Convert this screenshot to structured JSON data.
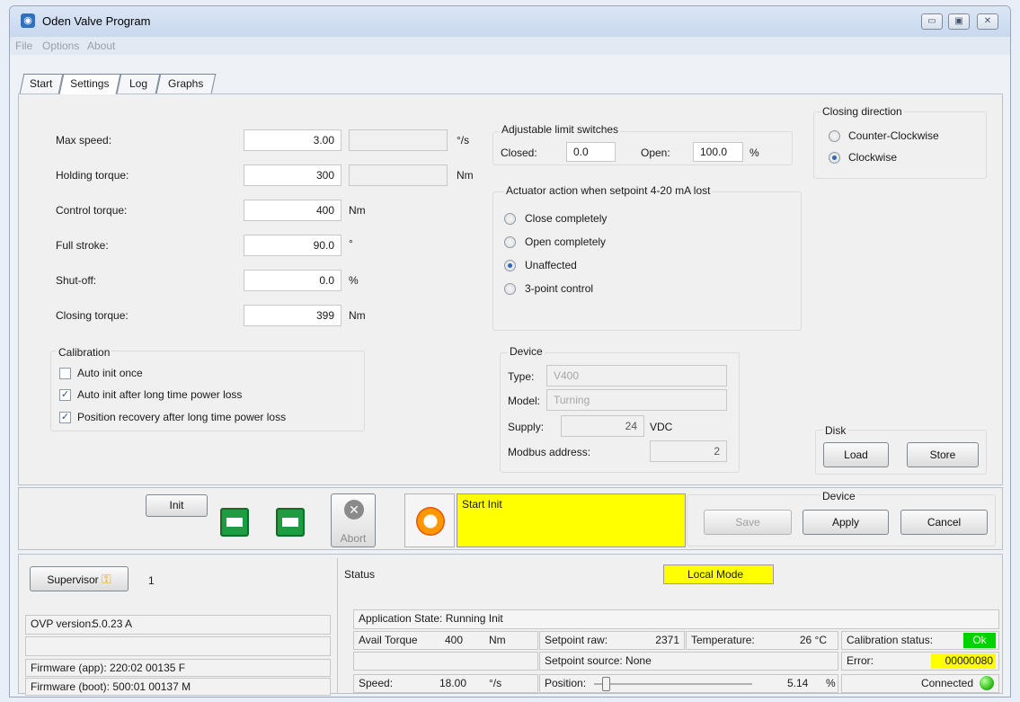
{
  "window": {
    "title": "Oden Valve Program",
    "menu": [
      "File",
      "Options",
      "About"
    ],
    "controls": [
      "minimize-icon",
      "maximize-icon",
      "close-icon"
    ]
  },
  "tabs": [
    "Start",
    "Settings",
    "Log",
    "Graphs"
  ],
  "active_tab": "Settings",
  "settings": {
    "max_speed": {
      "label": "Max speed:",
      "value": "3.00",
      "unit": "°/s"
    },
    "holding_torque": {
      "label": "Holding torque:",
      "value": "300",
      "unit": "Nm"
    },
    "control_torque": {
      "label": "Control torque:",
      "value": "400",
      "unit": "Nm"
    },
    "full_stroke": {
      "label": "Full stroke:",
      "value": "90.0",
      "unit": "°"
    },
    "shut_off": {
      "label": "Shut-off:",
      "value": "0.0",
      "unit": "%"
    },
    "closing_torque": {
      "label": "Closing torque:",
      "value": "399",
      "unit": "Nm"
    }
  },
  "calibration": {
    "title": "Calibration",
    "items": [
      {
        "label": "Auto init once",
        "checked": false
      },
      {
        "label": "Auto init after long time power loss",
        "checked": true
      },
      {
        "label": "Position recovery after long time power loss",
        "checked": true
      }
    ]
  },
  "limit_switches": {
    "title": "Adjustable limit switches",
    "closed_label": "Closed:",
    "closed_value": "0.0",
    "open_label": "Open:",
    "open_value": "100.0",
    "unit": "%"
  },
  "actuator_action": {
    "title": "Actuator action when setpoint 4-20 mA lost",
    "options": [
      "Close completely",
      "Open completely",
      "Unaffected",
      "3-point control"
    ],
    "selected": "Unaffected"
  },
  "device": {
    "title": "Device",
    "type_label": "Type:",
    "type_value": "V400",
    "model_label": "Model:",
    "model_value": "Turning",
    "supply_label": "Supply:",
    "supply_value": "24",
    "supply_unit": "VDC",
    "modbus_label": "Modbus address:",
    "modbus_value": "2"
  },
  "closing_direction": {
    "title": "Closing direction",
    "options": [
      "Counter-Clockwise",
      "Clockwise"
    ],
    "selected": "Clockwise"
  },
  "disk": {
    "title": "Disk",
    "load": "Load",
    "store": "Store"
  },
  "toolbar": {
    "init": "Init",
    "abort": "Abort",
    "message": "Start Init",
    "device_title": "Device",
    "save": "Save",
    "apply": "Apply",
    "cancel": "Cancel"
  },
  "bottom": {
    "supervisor": "Supervisor",
    "user_level": "1",
    "ovp_label": "OVP version:",
    "ovp_value": "5.0.23 A",
    "fw_app": "Firmware (app):  220:02 00135 F",
    "fw_boot": "Firmware (boot):  500:01 00137 M",
    "status_title": "Status",
    "local_mode": "Local Mode",
    "app_state": "Application State:  Running Init",
    "avail_torque_label": "Avail Torque",
    "avail_torque_value": "400",
    "avail_torque_unit": "Nm",
    "setpoint_raw_label": "Setpoint raw:",
    "setpoint_raw_value": "2371",
    "temperature_label": "Temperature:",
    "temperature_value": "26 °C",
    "calibration_label": "Calibration status:",
    "calibration_value": "Ok",
    "setpoint_source": "Setpoint source:  None",
    "error_label": "Error:",
    "error_value": "00000080",
    "speed_label": "Speed:",
    "speed_value": "18.00",
    "speed_unit": "°/s",
    "position_label": "Position:",
    "position_value": "5.14",
    "position_unit": "%",
    "position_fraction": 0.0514,
    "connected": "Connected"
  },
  "colors": {
    "highlight_yellow": "#ffff00",
    "ok_green": "#00d200",
    "accent_blue": "#2f66b6"
  }
}
